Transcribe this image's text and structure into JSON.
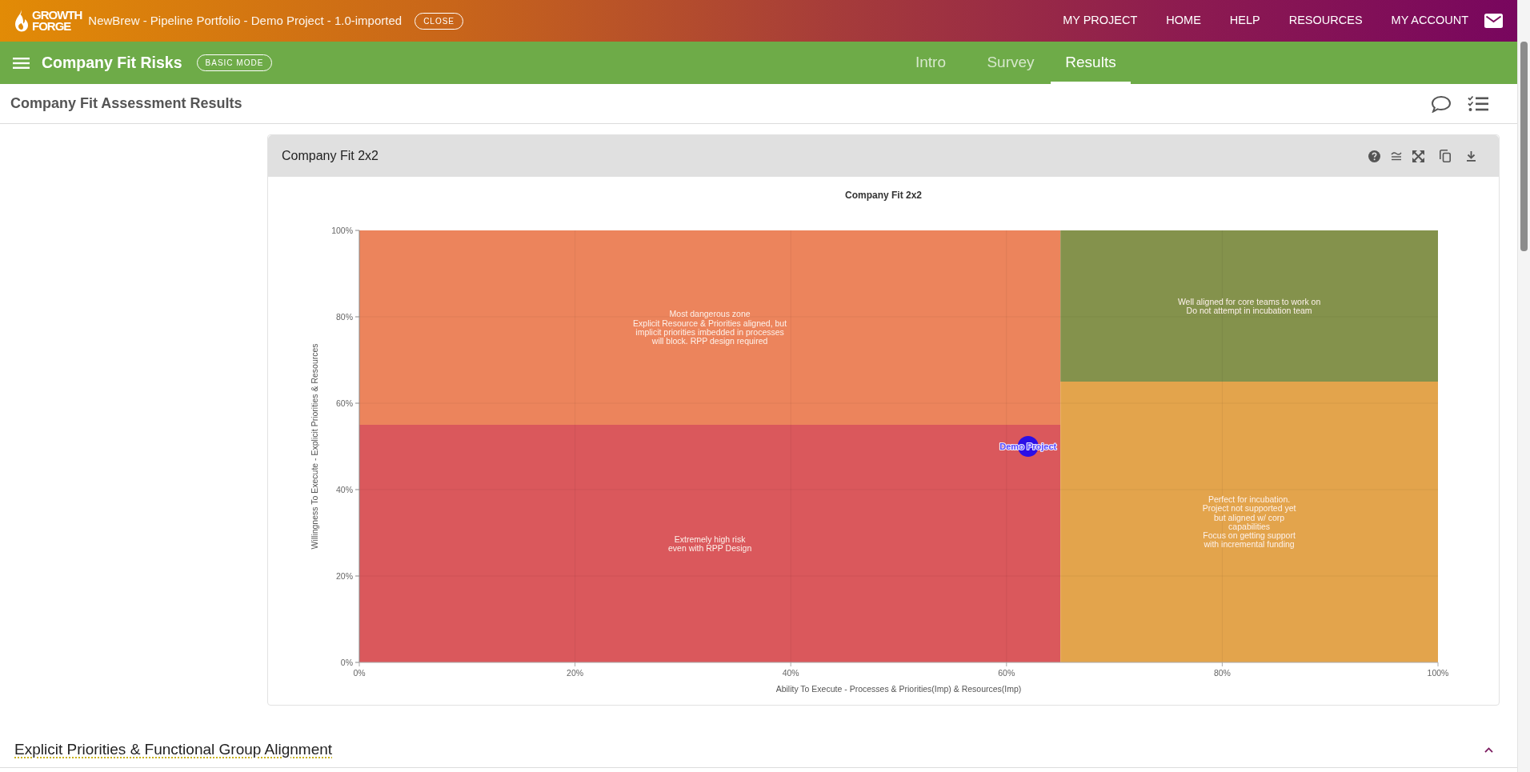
{
  "header": {
    "logo_lines": [
      "GROWTH",
      "FORGE"
    ],
    "title": "NewBrew - Pipeline Portfolio - Demo Project - 1.0-imported",
    "close_button": "CLOSE",
    "nav_links": [
      "MY PROJECT",
      "HOME",
      "HELP",
      "RESOURCES",
      "MY ACCOUNT"
    ]
  },
  "toolbar": {
    "title": "Company Fit Risks",
    "mode_badge": "BASIC MODE",
    "tabs": [
      {
        "label": "Intro",
        "selected": false
      },
      {
        "label": "Survey",
        "selected": false
      },
      {
        "label": "Results",
        "selected": true
      }
    ]
  },
  "page_title": "Company Fit Assessment Results",
  "chart_card": {
    "title": "Company Fit 2x2",
    "chart_data": {
      "type": "scatter",
      "title": "Company Fit 2x2",
      "xlabel": "Ability To Execute - Processes & Priorities(Imp) & Resources(Imp)",
      "ylabel": "Willingness To Execute - Explicit Priorities & Resources",
      "xlim": [
        0,
        100
      ],
      "ylim": [
        0,
        100
      ],
      "xticks": [
        {
          "value": 0,
          "label": "0%"
        },
        {
          "value": 20,
          "label": "20%"
        },
        {
          "value": 40,
          "label": "40%"
        },
        {
          "value": 60,
          "label": "60%"
        },
        {
          "value": 80,
          "label": "80%"
        },
        {
          "value": 100,
          "label": "100%"
        }
      ],
      "yticks": [
        {
          "value": 0,
          "label": "0%"
        },
        {
          "value": 20,
          "label": "20%"
        },
        {
          "value": 40,
          "label": "40%"
        },
        {
          "value": 60,
          "label": "60%"
        },
        {
          "value": 80,
          "label": "80%"
        },
        {
          "value": 100,
          "label": "100%"
        }
      ],
      "grid": true,
      "x": [
        62
      ],
      "series": [
        {
          "name": "Demo Project",
          "color": "#2b0fe6",
          "values": [
            50
          ]
        }
      ]
    },
    "zones": [
      {
        "color": "#ec845c",
        "lines": [
          "Most dangerous zone",
          "Explicit Resource & Priorities aligned, but",
          "implicit priorities imbedded in processes",
          "will block. RPP design required"
        ]
      },
      {
        "color": "#84924c",
        "lines": [
          "Well aligned for core teams to work on",
          "Do not attempt in incubation team"
        ]
      },
      {
        "color": "#da585c",
        "lines": [
          "Extremely high risk",
          "even with RPP Design"
        ]
      },
      {
        "color": "#e3a44c",
        "lines": [
          "Perfect for incubation.",
          "Project not supported yet",
          "but aligned w/ corp",
          "capabilities",
          "Focus on getting support",
          "with incremental funding"
        ]
      }
    ]
  },
  "sections": [
    {
      "title": "Explicit Priorities & Functional Group Alignment",
      "expanded": true
    }
  ]
}
